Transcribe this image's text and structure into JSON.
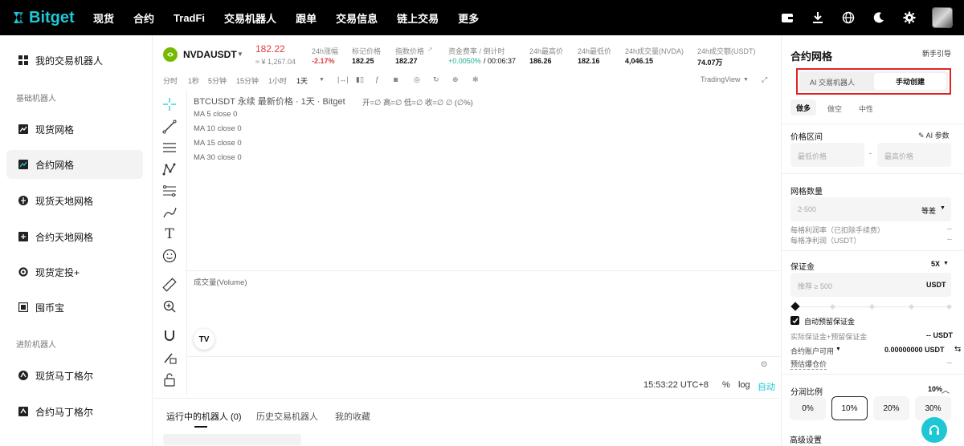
{
  "nav": {
    "logo": "Bitget",
    "items": [
      "现货",
      "合约",
      "TradFi",
      "交易机器人",
      "跟单",
      "交易信息",
      "链上交易",
      "更多"
    ]
  },
  "sidebar": {
    "my_bots": "我的交易机器人",
    "section_basic": "基础机器人",
    "basic_items": [
      "现货网格",
      "合约网格",
      "现货天地网格",
      "合约天地网格",
      "现货定投+",
      "囤币宝"
    ],
    "section_advanced": "进阶机器人",
    "advanced_items": [
      "现货马丁格尔",
      "合约马丁格尔"
    ]
  },
  "ticker": {
    "symbol": "NVDAUSDT",
    "price": "182.22",
    "price_cny": "≈ ¥ 1,267.04",
    "change_label": "24h涨幅",
    "change_value": "-2.17%",
    "mark_label": "标记价格",
    "mark_value": "182.25",
    "index_label": "指数价格",
    "index_value": "182.27",
    "funding_label": "资金费率 / 倒计时",
    "funding_rate": "+0.0050%",
    "funding_countdown": "/ 00:06:37",
    "high_label": "24h最高价",
    "high_value": "186.26",
    "low_label": "24h最低价",
    "low_value": "182.16",
    "vol_label": "24h成交量(NVDA)",
    "vol_value": "4,046.15",
    "turnover_label": "24h成交额(USDT)",
    "turnover_value": "74.07万"
  },
  "toolbar": {
    "intervals": [
      "分时",
      "1秒",
      "5分钟",
      "15分钟",
      "1小时",
      "1天"
    ],
    "selected_interval": "1天",
    "tradingview": "TradingView"
  },
  "chart": {
    "legend_title": "BTCUSDT 永续 最新价格 · 1天 · Bitget",
    "legend_ohlc": "开=∅  高=∅  低=∅  收=∅  ∅ (∅%)",
    "ma": [
      "MA 5 close 0",
      "MA 10 close 0",
      "MA 15 close 0",
      "MA 30 close 0"
    ],
    "volume_label": "成交量(Volume)",
    "time": "15:53:22 UTC+8",
    "pct": "%",
    "log": "log",
    "auto": "自动"
  },
  "bottom_tabs": [
    "运行中的机器人 (0)",
    "历史交易机器人",
    "我的收藏"
  ],
  "panel": {
    "title": "合约网格",
    "guide": "新手引导",
    "mode_ai": "AI 交易机器人",
    "mode_manual": "手动创建",
    "dir_long": "做多",
    "dir_short": "做空",
    "dir_neutral": "中性",
    "range_label": "价格区间",
    "ai_params": "AI 参数",
    "min_ph": "最低价格",
    "max_ph": "最高价格",
    "dash": "-",
    "grid_label": "网格数量",
    "grid_ph": "2-500",
    "grid_mode": "等差",
    "profit_label": "每格利润率（已扣除手续费）",
    "profit_value": "--",
    "net_label": "每格净利润（USDT）",
    "net_value": "--",
    "margin_label": "保证金",
    "leverage": "5X",
    "margin_ph": "推荐 ≥ 500",
    "margin_unit": "USDT",
    "auto_margin": "自动预留保证金",
    "actual_margin_label": "实际保证金+预留保证金",
    "actual_margin_value": "-- USDT",
    "available_label": "合约账户可用",
    "available_value": "0.00000000 USDT",
    "liq_label": "预估爆仓价",
    "liq_value": "--",
    "split_label": "分润比例",
    "split_value": "10%",
    "split_options": [
      "0%",
      "10%",
      "20%",
      "30%"
    ],
    "advanced": "高级设置"
  },
  "colors": {
    "brand": "#1fc7d4",
    "down": "#e03c3c",
    "up": "#1dae8a",
    "highlight": "#e02424"
  }
}
